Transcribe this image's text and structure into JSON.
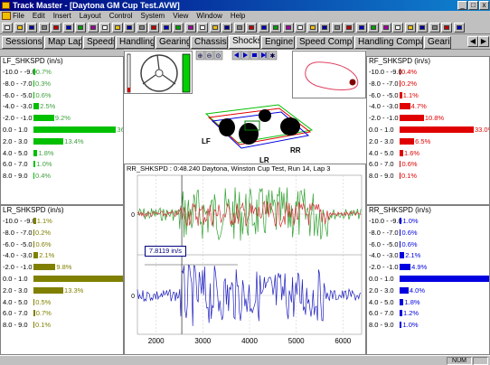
{
  "window": {
    "title": "Track Master - [Daytona GM Cup Test.AVW]"
  },
  "menu": [
    "File",
    "Edit",
    "Insert",
    "Layout",
    "Control",
    "System",
    "View",
    "Window",
    "Help"
  ],
  "tabs": [
    {
      "label": "Sessions",
      "active": false
    },
    {
      "label": "Map Lap",
      "active": false
    },
    {
      "label": "Speeds",
      "active": false
    },
    {
      "label": "Handling",
      "active": false
    },
    {
      "label": "Gearing",
      "active": false
    },
    {
      "label": "Chassis",
      "active": false
    },
    {
      "label": "Shocks",
      "active": true
    },
    {
      "label": "Engine",
      "active": false
    },
    {
      "label": "Speed Compare",
      "active": false
    },
    {
      "label": "Handling Compare",
      "active": false
    },
    {
      "label": "Gearin",
      "active": false
    }
  ],
  "histograms": {
    "lf": {
      "title": "LF_SHKSPD (in/s)",
      "color": "#00c000",
      "pct_color": "#40a040",
      "rows": [
        {
          "label": "-10.0 - -9.0",
          "pct": "0.7%",
          "frac": 0.007
        },
        {
          "label": "-8.0 - -7.0",
          "pct": "0.3%",
          "frac": 0.003
        },
        {
          "label": "-6.0 - -5.0",
          "pct": "0.6%",
          "frac": 0.006
        },
        {
          "label": "-4.0 - -3.0",
          "pct": "2.5%",
          "frac": 0.025
        },
        {
          "label": "-2.0 - -1.0",
          "pct": "9.2%",
          "frac": 0.092
        },
        {
          "label": "0.0 - 1.0",
          "pct": "36.8%",
          "frac": 0.368
        },
        {
          "label": "2.0 - 3.0",
          "pct": "13.4%",
          "frac": 0.134
        },
        {
          "label": "4.0 - 5.0",
          "pct": "1.8%",
          "frac": 0.018
        },
        {
          "label": "6.0 - 7.0",
          "pct": "1.0%",
          "frac": 0.01
        },
        {
          "label": "8.0 - 9.0",
          "pct": "0.4%",
          "frac": 0.004
        }
      ]
    },
    "lr": {
      "title": "LR_SHKSPD (in/s)",
      "color": "#808000",
      "pct_color": "#808000",
      "rows": [
        {
          "label": "-10.0 - -9.0",
          "pct": "1.1%",
          "frac": 0.011
        },
        {
          "label": "-8.0 - -7.0",
          "pct": "0.2%",
          "frac": 0.002
        },
        {
          "label": "-6.0 - -5.0",
          "pct": "0.6%",
          "frac": 0.006
        },
        {
          "label": "-4.0 - -3.0",
          "pct": "2.1%",
          "frac": 0.021
        },
        {
          "label": "-2.0 - -1.0",
          "pct": "9.8%",
          "frac": 0.098
        },
        {
          "label": "0.0 - 1.0",
          "pct": "46.4%",
          "frac": 0.464
        },
        {
          "label": "2.0 - 3.0",
          "pct": "13.3%",
          "frac": 0.133
        },
        {
          "label": "4.0 - 5.0",
          "pct": "0.5%",
          "frac": 0.005
        },
        {
          "label": "6.0 - 7.0",
          "pct": "0.7%",
          "frac": 0.007
        },
        {
          "label": "8.0 - 9.0",
          "pct": "0.1%",
          "frac": 0.001
        }
      ]
    },
    "rf": {
      "title": "RF_SHKSPD (in/s)",
      "color": "#e00000",
      "pct_color": "#e00000",
      "rows": [
        {
          "label": "-10.0 - -9.0",
          "pct": "0.4%",
          "frac": 0.004
        },
        {
          "label": "-8.0 - -7.0",
          "pct": "0.2%",
          "frac": 0.002
        },
        {
          "label": "-6.0 - -5.0",
          "pct": "1.1%",
          "frac": 0.011
        },
        {
          "label": "-4.0 - -3.0",
          "pct": "4.7%",
          "frac": 0.047
        },
        {
          "label": "-2.0 - -1.0",
          "pct": "10.8%",
          "frac": 0.108
        },
        {
          "label": "0.0 - 1.0",
          "pct": "33.0%",
          "frac": 0.33
        },
        {
          "label": "2.0 - 3.0",
          "pct": "6.5%",
          "frac": 0.065
        },
        {
          "label": "4.0 - 5.0",
          "pct": "1.6%",
          "frac": 0.016
        },
        {
          "label": "6.0 - 7.0",
          "pct": "0.6%",
          "frac": 0.006
        },
        {
          "label": "8.0 - 9.0",
          "pct": "0.1%",
          "frac": 0.001
        }
      ]
    },
    "rr": {
      "title": "RR_SHKSPD (in/s)",
      "color": "#0000e0",
      "pct_color": "#0000e0",
      "rows": [
        {
          "label": "-10.0 - -9.0",
          "pct": "1.0%",
          "frac": 0.01
        },
        {
          "label": "-8.0 - -7.0",
          "pct": "0.6%",
          "frac": 0.006
        },
        {
          "label": "-6.0 - -5.0",
          "pct": "0.6%",
          "frac": 0.006
        },
        {
          "label": "-4.0 - -3.0",
          "pct": "2.1%",
          "frac": 0.021
        },
        {
          "label": "-2.0 - -1.0",
          "pct": "4.9%",
          "frac": 0.049
        },
        {
          "label": "0.0 - 1.0",
          "pct": "41.4%",
          "frac": 0.414
        },
        {
          "label": "2.0 - 3.0",
          "pct": "4.0%",
          "frac": 0.04
        },
        {
          "label": "4.0 - 5.0",
          "pct": "1.8%",
          "frac": 0.018
        },
        {
          "label": "6.0 - 7.0",
          "pct": "1.2%",
          "frac": 0.012
        },
        {
          "label": "8.0 - 9.0",
          "pct": "1.0%",
          "frac": 0.01
        }
      ]
    }
  },
  "car_view": {
    "labels": [
      "LF",
      "LR",
      "RR"
    ]
  },
  "chart_data": {
    "type": "line",
    "title": "RR_SHKSPD : 0:48.240 Daytona, Winston Cup Test, Run 14, Lap 3",
    "x_ticks": [
      "2000",
      "3000",
      "4000",
      "5000",
      "6000"
    ],
    "y_ticks": [
      "0",
      "0"
    ],
    "xlim": [
      1600,
      6400
    ],
    "series": [
      {
        "color": "#30a030"
      },
      {
        "color": "#d03030"
      },
      {
        "color": "#2020c0"
      }
    ],
    "cursor_readout": "7.8119 in/s",
    "cursor_x": 2550
  },
  "status": {
    "num": "NUM"
  }
}
